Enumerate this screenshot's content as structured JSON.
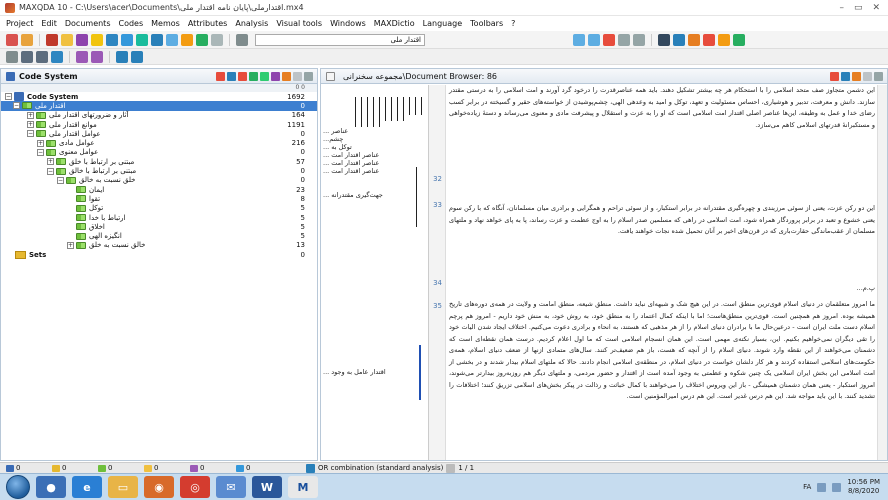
{
  "window": {
    "title": "MAXQDA 10 - C:\\Users\\acer\\Documents\\اقتدارملی\\پایان نامه اقتدار ملی.mx4",
    "minimize": "–",
    "maximize": "▭",
    "close": "✕"
  },
  "menu": [
    "Project",
    "Edit",
    "Documents",
    "Codes",
    "Memos",
    "Attributes",
    "Analysis",
    "Visual tools",
    "Windows",
    "MAXDictio",
    "Language",
    "Toolbars",
    "?"
  ],
  "toolbar": {
    "document_select": "اقتدار ملی"
  },
  "code_system": {
    "title": "Code System",
    "column_header": "0  0",
    "root_label": "Code System",
    "root_count": "1692",
    "items": [
      {
        "label": "اقتدار ملی",
        "count": "0",
        "depth": 1,
        "selected": true
      },
      {
        "label": "آثار و ضرورتهای اقتدار ملی",
        "count": "164",
        "depth": 2
      },
      {
        "label": "موانع اقتدار ملی",
        "count": "1191",
        "depth": 2
      },
      {
        "label": "عوامل اقتدار ملی",
        "count": "0",
        "depth": 2
      },
      {
        "label": "عوامل مادی",
        "count": "216",
        "depth": 3
      },
      {
        "label": "عوامل معنوی",
        "count": "0",
        "depth": 3
      },
      {
        "label": "مبتنی بر ارتباط با خلق",
        "count": "57",
        "depth": 4
      },
      {
        "label": "مبتنی بر ارتباط با خالق",
        "count": "0",
        "depth": 4
      },
      {
        "label": "خلق نسبت به خالق",
        "count": "0",
        "depth": 5
      },
      {
        "label": "ایمان",
        "count": "23",
        "depth": 6
      },
      {
        "label": "تقوا",
        "count": "8",
        "depth": 6
      },
      {
        "label": "توکل",
        "count": "5",
        "depth": 6
      },
      {
        "label": "ارتباط با خدا",
        "count": "5",
        "depth": 6
      },
      {
        "label": "اخلاق",
        "count": "5",
        "depth": 6
      },
      {
        "label": "انگیزه الهی",
        "count": "5",
        "depth": 6
      },
      {
        "label": "خالق نسبت به خلق",
        "count": "13",
        "depth": 5
      }
    ],
    "sets_label": "Sets",
    "sets_count": "0"
  },
  "document_browser": {
    "title": "Document Browser: 86\\مجموعه سخنرانی",
    "line_numbers": [
      "32",
      "33",
      "34",
      "35"
    ],
    "code_labels": [
      "عناصر ...",
      "چشم...",
      "توکل به ...",
      "عناصر اقتدار امت ...",
      "عناصر اقتدار امت ...",
      "عناصر اقتدار امت ...",
      "جهت‌گیری مقتدرانه ...",
      "اقتدار عامل به وجود ..."
    ],
    "paragraphs": [
      "این دشمن متجاوز صف متحد اسلامی را با استحکام هر چه بیشتر تشکیل دهند. باید همه عناصرقدرت را درخود گرد آورند و امت اسلامی را به درستی مقتدر سازند. دانش و معرفت، تدبیر و هوشیاری، احساس مسئولیت و تعهد، توکل و امید به وعدهی الهی، چشم‌پوشیدن از خواسته‌های حقیر و گسیخته در برابر کسب رضای خدا و عمل به وظیفه، این‌ها عناصر اصلی اقتدار امت اسلامی است که او را به عزت و استقلال و پیشرفت مادی و معنوی می‌رساند و دستهٔ زیاده‌خواهی و مستکبرانهٔ قدرتهای اسلامی کاهم می‌سازد.",
      "این دو رکن عزت، یعنی از سوئی مرزبندی و چهره‌گیری مقتدرانه در برابر استکبار، و از سوئی تراحم و همگرایی و برادری میان مسلمانان، آنگاه که با رکن سوم یعنی خشوع و تعبد در برابر پروردگار همراه شود، امت اسلامی در راهی که مسلمین صدر اسلام را به اوج عظمت و عزت رساند، پا به پای خواهد نهاد و ملتهای مسلمان از عقب‌ماندگی حقارت‌باری که در قرن‌های اخیر بر آنان تحمیل شده نجات خواهند یافت.",
      "ما امروز متعلقمان در دنیای اسلام قوی‌ترین منطق است. در این هیچ شک و شبهه‌ای نباید داشت. منطق شیعه، منطق امامت و ولایت در همه‌ی دوره‌های تاریخ همیشه بوده. امروز هم همچنین است. قوی‌ترین منطق‌هاست؛ اما با اینکه کمال اعتماد را به منطق خود، به روش خود، به منش خود داریم - امروز هم پرچم اسلام دست ملت ایران است - درعین‌حال ما با برادران دنیای اسلام را از هر مذهبی که هستند، به انحاء و برادری دعوت می‌کنیم. اختلاف ایجاد شدن الیات خود را تقی دیگران نمی‌خواهیم بکنیم. این، بسیار نکته‌ی مهمی است. این همان انسجام اسلامی است که ما اول اعلام کردیم. درست همان نقطه‌ای است که دشمنان می‌خواهند از این نقطه وارد شوند. دنیای اسلام را از آنچه که هست، باز هم ضعیف‌تر کنند. سال‌های متمادی ازنها از ضعف دنیای اسلام، همه‌ی حکومت‌های اسلامی استفاده کردند و هر کار دلشان خواست در دنیای اسلام، در منطقه‌ی اسلامی انجام دادند. حالا که ملتهای اسلام بیدار شدند و در بخشی از امت اسلامی این بخش ایران اسلامی یک چنین شکوه و عظمتی به وجود آمده است از اقتدار و حضور مردمی، و ملتهای دیگر هم روزبه‌روز بیدارتر می‌شوند، امروز استکبار - یعنی همان دشمنان همیشگی - باز این ویروس اختلاف را می‌خواهند با کمال خباثت و رذالت در پیکر بخش‌های اسلامی تزریق کنند؛ اختلافات را تشدید کنند. با این باید مواجه شد. این هم درس غدیر است. این هم درس امیرالمؤمنین است."
    ],
    "heading_34": "پ.م..."
  },
  "statusbar": {
    "counts": [
      "0",
      "0",
      "0",
      "0",
      "0",
      "0"
    ],
    "mode": "OR combination (standard analysis)",
    "pager": "1 / 1"
  },
  "taskbar": {
    "apps": [
      "explorer",
      "media",
      "ie",
      "folder",
      "firefox",
      "chrome",
      "mail",
      "word",
      "maxqda"
    ],
    "lang": "FA",
    "time": "10:56 PM",
    "date": "8/8/2020"
  },
  "colors": {
    "accent": "#3d7fd0",
    "code_green": "#6fbf3c",
    "panel_border": "#b8c8d8",
    "taskbar": "#c6dcef"
  }
}
